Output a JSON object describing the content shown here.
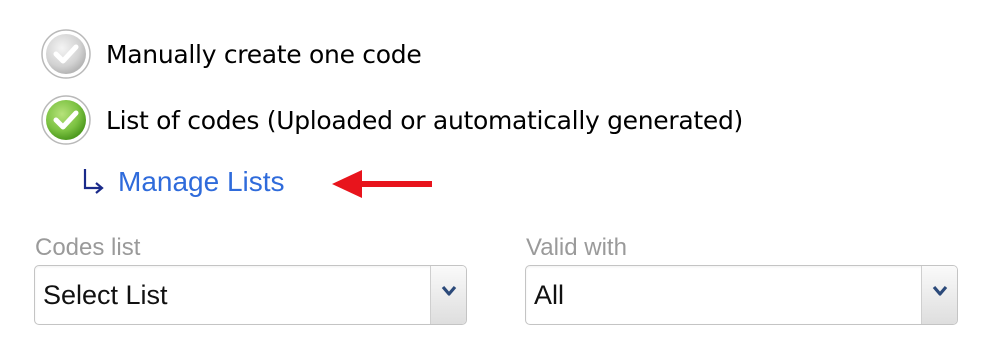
{
  "options": [
    {
      "label": "Manually create one code",
      "selected": false,
      "icon": "radio-unchecked-icon"
    },
    {
      "label": "List of codes (Uploaded or automatically generated)",
      "selected": true,
      "icon": "radio-checked-icon"
    }
  ],
  "manage_lists": {
    "label": "Manage Lists",
    "icon": "sub-arrow-icon",
    "pointer_icon": "red-arrow-icon"
  },
  "fields": {
    "codes_list": {
      "label": "Codes list",
      "value": "Select List"
    },
    "valid_with": {
      "label": "Valid with",
      "value": "All"
    }
  },
  "colors": {
    "link": "#2f6bdb",
    "selected_radio": "#7cc242",
    "unselected_radio": "#d4d4d4",
    "pointer_arrow": "#e8141c",
    "field_label": "#9a9a9a",
    "dropdown_chevron": "#2c4a7a"
  }
}
